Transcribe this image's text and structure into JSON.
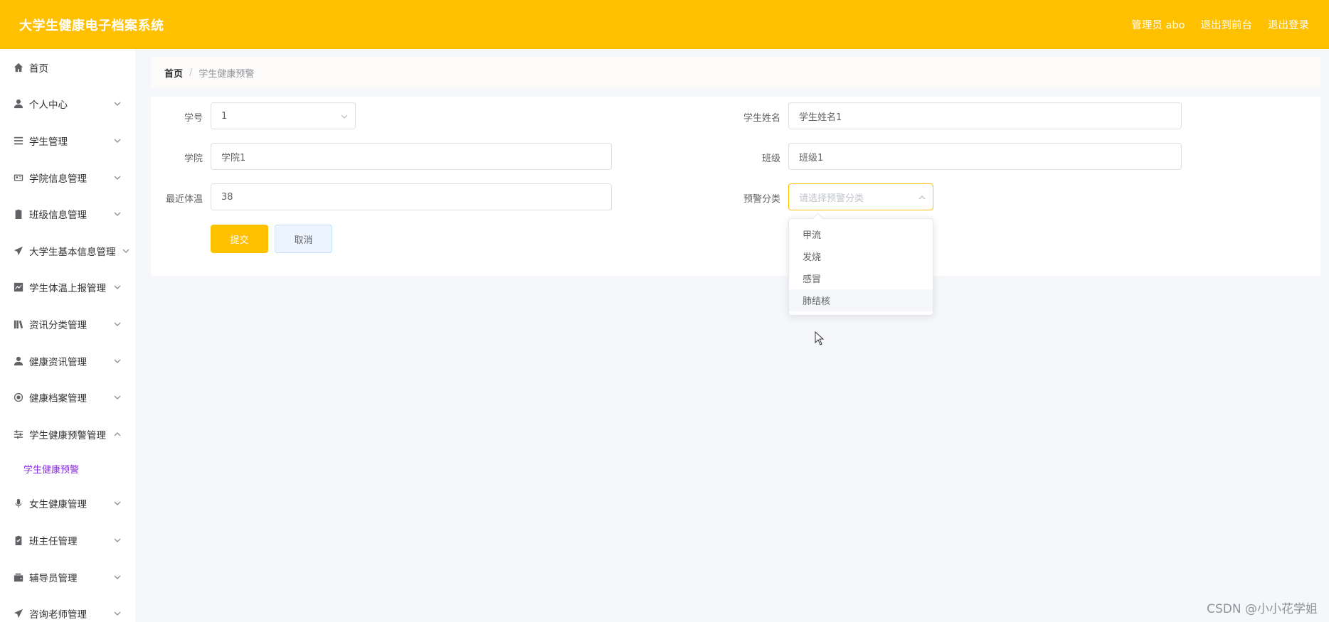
{
  "header": {
    "title": "大学生健康电子档案系统",
    "admin": "管理员 abo",
    "to_front": "退出到前台",
    "logout": "退出登录",
    "color": "#ffc000"
  },
  "sidebar": {
    "items": [
      {
        "label": "首页",
        "icon": "home-icon"
      },
      {
        "label": "个人中心",
        "icon": "user-icon"
      },
      {
        "label": "学生管理",
        "icon": "list-icon"
      },
      {
        "label": "学院信息管理",
        "icon": "id-card-icon"
      },
      {
        "label": "班级信息管理",
        "icon": "clipboard-icon"
      },
      {
        "label": "大学生基本信息管理",
        "icon": "send-icon"
      },
      {
        "label": "学生体温上报管理",
        "icon": "chart-icon"
      },
      {
        "label": "资讯分类管理",
        "icon": "books-icon"
      },
      {
        "label": "健康资讯管理",
        "icon": "user-icon"
      },
      {
        "label": "健康档案管理",
        "icon": "lifebuoy-icon"
      },
      {
        "label": "学生健康预警管理",
        "icon": "sliders-icon"
      },
      {
        "label": "女生健康管理",
        "icon": "microphone-icon"
      },
      {
        "label": "班主任管理",
        "icon": "clipboard-check-icon"
      },
      {
        "label": "辅导员管理",
        "icon": "wallet-icon"
      },
      {
        "label": "咨询老师管理",
        "icon": "send-icon"
      }
    ],
    "active_sub": "学生健康预警"
  },
  "breadcrumb": {
    "home": "首页",
    "sep": "/",
    "current": "学生健康预警"
  },
  "form": {
    "student_no_label": "学号",
    "student_no_value": "1",
    "student_name_label": "学生姓名",
    "student_name_value": "学生姓名1",
    "college_label": "学院",
    "college_value": "学院1",
    "class_label": "班级",
    "class_value": "班级1",
    "temp_label": "最近体温",
    "temp_value": "38",
    "category_label": "预警分类",
    "category_placeholder": "请选择预警分类",
    "submit": "提交",
    "cancel": "取消"
  },
  "dropdown": {
    "options": [
      "甲流",
      "发烧",
      "感冒",
      "肺结核"
    ]
  },
  "watermark": "CSDN @小小花学姐"
}
